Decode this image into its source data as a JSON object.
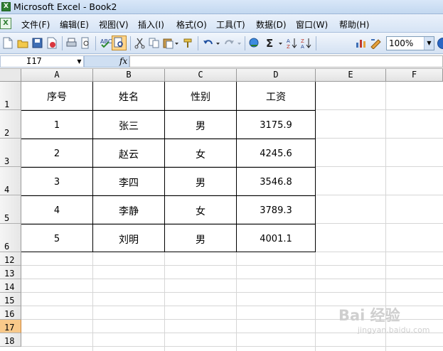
{
  "app": {
    "title": "Microsoft Excel - Book2",
    "icon_text": "X"
  },
  "menu": [
    "文件(F)",
    "编辑(E)",
    "视图(V)",
    "插入(I)",
    "格式(O)",
    "工具(T)",
    "数据(D)",
    "窗口(W)",
    "帮助(H)"
  ],
  "toolbar": {
    "zoom": "100%"
  },
  "formula_bar": {
    "cell_ref": "I17",
    "fx": "fx",
    "content": ""
  },
  "columns": [
    "A",
    "B",
    "C",
    "D",
    "E",
    "F"
  ],
  "rows": [
    "1",
    "2",
    "3",
    "4",
    "5",
    "6",
    "12",
    "13",
    "14",
    "15",
    "16",
    "17",
    "18"
  ],
  "active_row": "17",
  "table": {
    "headers": [
      "序号",
      "姓名",
      "性别",
      "工资"
    ],
    "rows": [
      [
        "1",
        "张三",
        "男",
        "3175.9"
      ],
      [
        "2",
        "赵云",
        "女",
        "4245.6"
      ],
      [
        "3",
        "李四",
        "男",
        "3546.8"
      ],
      [
        "4",
        "李静",
        "女",
        "3789.3"
      ],
      [
        "5",
        "刘明",
        "男",
        "4001.1"
      ]
    ]
  },
  "watermark": {
    "main": "Bai 经验",
    "sub": "jingyan.baidu.com"
  }
}
